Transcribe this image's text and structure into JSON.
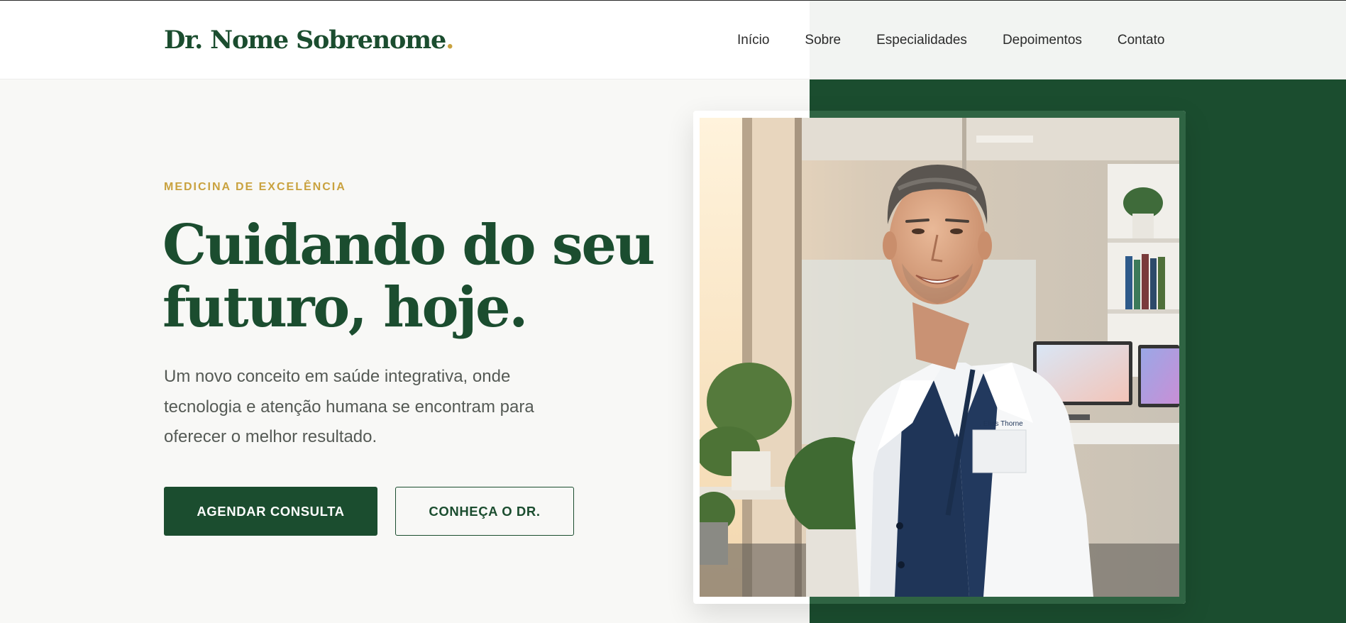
{
  "brand": {
    "name": "Dr. Nome Sobrenome",
    "dot": "."
  },
  "nav": {
    "items": [
      {
        "label": "Início"
      },
      {
        "label": "Sobre"
      },
      {
        "label": "Especialidades"
      },
      {
        "label": "Depoimentos"
      },
      {
        "label": "Contato"
      }
    ]
  },
  "hero": {
    "eyebrow": "MEDICINA DE EXCELÊNCIA",
    "headline_line1": "Cuidando do seu",
    "headline_line2": "futuro, hoje.",
    "subtext": "Um novo conceito em saúde integrativa, onde tecnologia e atenção humana se encontram para oferecer o melhor resultado.",
    "primary_button": "AGENDAR CONSULTA",
    "secondary_button": "CONHEÇA O DR."
  },
  "photo": {
    "coat_name_tag": ". Elias Thorne"
  },
  "colors": {
    "brand_green": "#1b4d2f",
    "accent_gold": "#c9a23f",
    "background": "#f8f8f6"
  }
}
